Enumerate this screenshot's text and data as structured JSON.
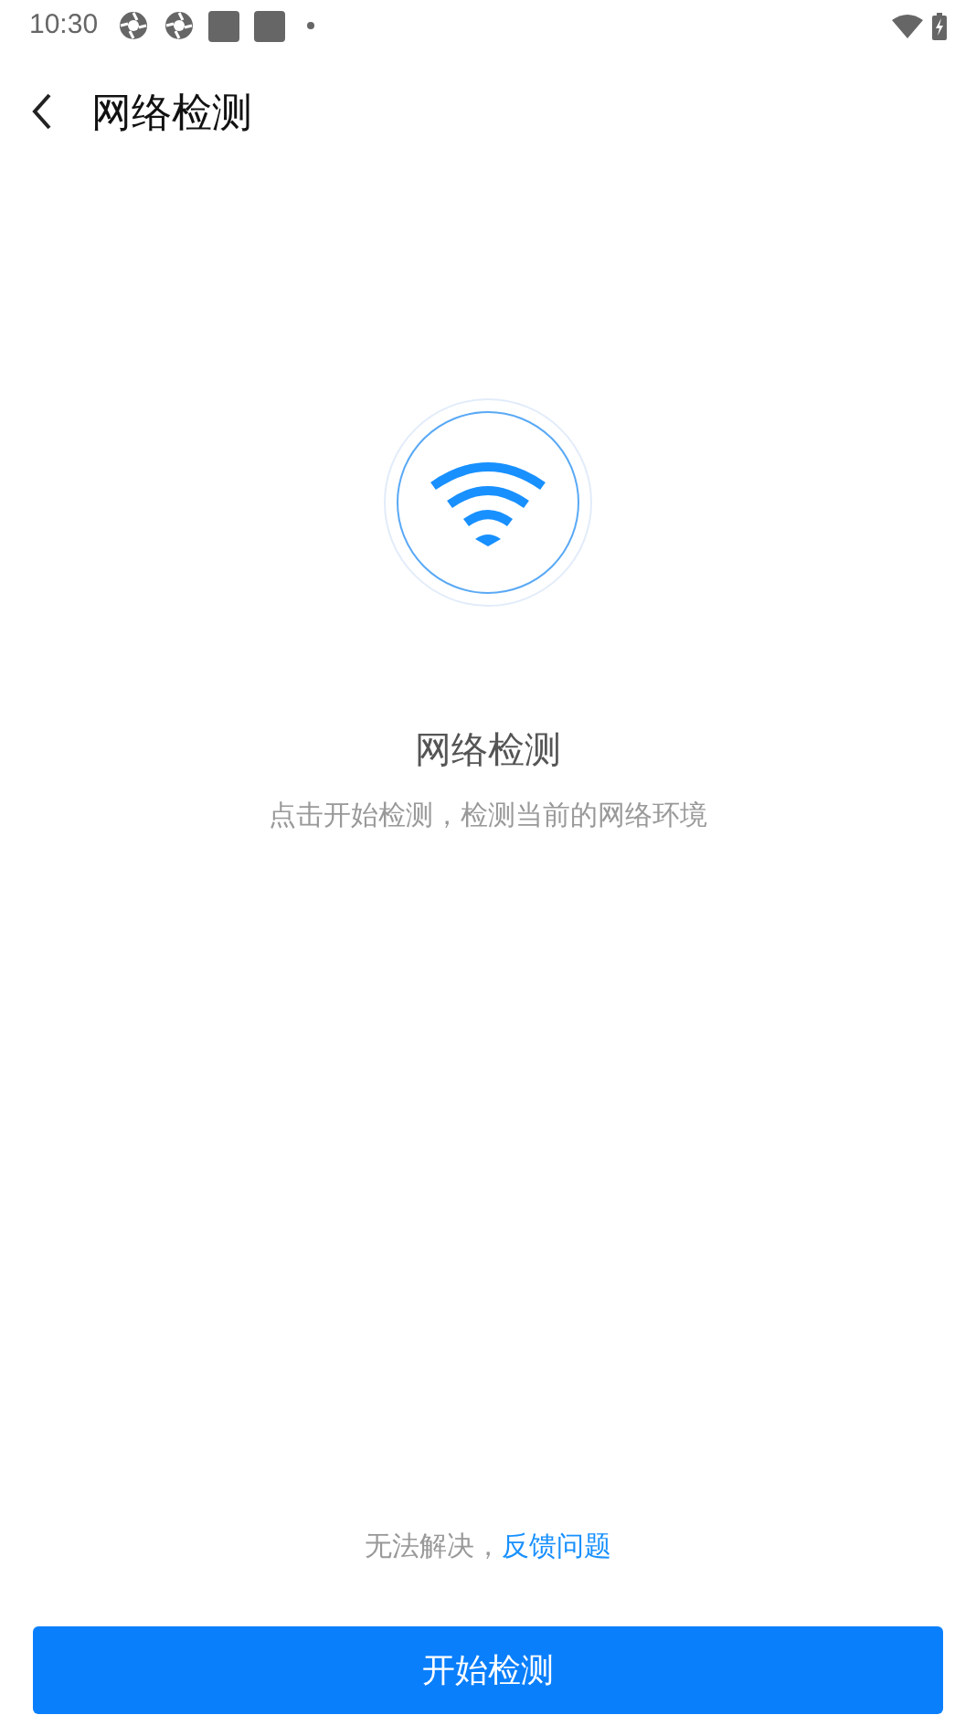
{
  "status_bar": {
    "time": "10:30"
  },
  "header": {
    "title": "网络检测"
  },
  "hero": {
    "title": "网络检测",
    "subtitle": "点击开始检测，检测当前的网络环境"
  },
  "feedback": {
    "text": "无法解决，",
    "link": "反馈问题"
  },
  "start_button": {
    "label": "开始检测"
  }
}
